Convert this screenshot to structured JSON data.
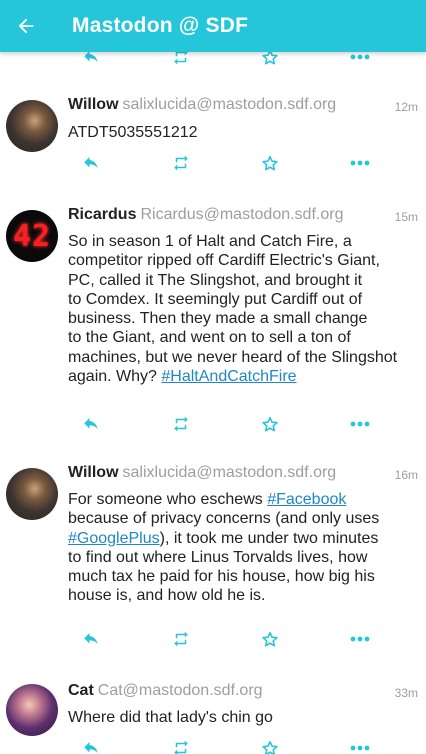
{
  "appbar": {
    "title": "Mastodon @ SDF",
    "color": "#26c6da"
  },
  "icons": {
    "back": "arrow-left-icon",
    "reply": "reply-icon",
    "boost": "boost-icon",
    "favourite": "star-icon",
    "more": "more-icon"
  },
  "statuses": [
    {
      "name": "Willow",
      "handle": "salixlucida@mastodon.sdf.org",
      "time": "12m",
      "lines": [
        "ATDT5035551212"
      ]
    },
    {
      "name": "Ricardus",
      "handle": "Ricardus@mastodon.sdf.org",
      "time": "15m",
      "avatar_text": "42",
      "lines": [
        "So in season 1 of Halt and Catch Fire, a",
        "competitor ripped off Cardiff Electric's Giant,",
        "PC, called it The Slingshot, and brought it",
        "to Comdex. It seemingly put Cardiff out of",
        "business. Then they made a small change",
        "to the Giant, and went on to sell a ton of",
        "machines, but we never heard of the Slingshot",
        "again. Why?"
      ],
      "hashtag": "#HaltAndCatchFire"
    },
    {
      "name": "Willow",
      "handle": "salixlucida@mastodon.sdf.org",
      "time": "16m",
      "l1_pre": "For someone who eschews ",
      "l1_tag": "#Facebook",
      "l2": "because of privacy concerns (and only uses",
      "l3_tag": "#GooglePlus",
      "l3_post": "), it took me under two minutes",
      "l4": "to find out where Linus Torvalds lives, how",
      "l5": "much tax he paid for his house, how big his",
      "l6": "house is, and how old he is."
    },
    {
      "name": "Cat",
      "handle": "Cat@mastodon.sdf.org",
      "time": "33m",
      "lines": [
        "Where did that lady's chin go"
      ]
    }
  ]
}
